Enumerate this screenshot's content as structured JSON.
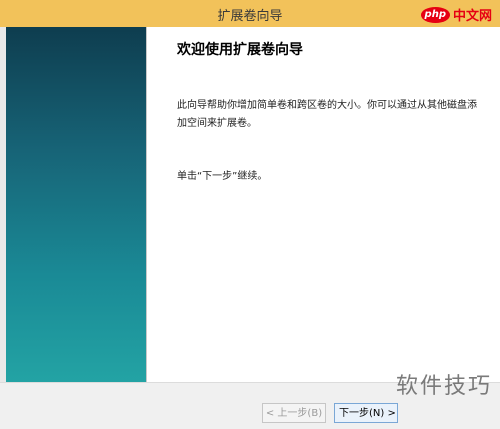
{
  "window": {
    "title": "扩展卷向导"
  },
  "watermark_top": {
    "php": "php",
    "cn": "中文网"
  },
  "content": {
    "heading": "欢迎使用扩展卷向导",
    "description": "此向导帮助你增加简单卷和跨区卷的大小。你可以通过从其他磁盘添加空间来扩展卷。",
    "instruction": "单击“下一步”继续。"
  },
  "buttons": {
    "back": "< 上一步(B)",
    "next": "下一步(N) >"
  },
  "watermark_bottom": "软件技巧"
}
